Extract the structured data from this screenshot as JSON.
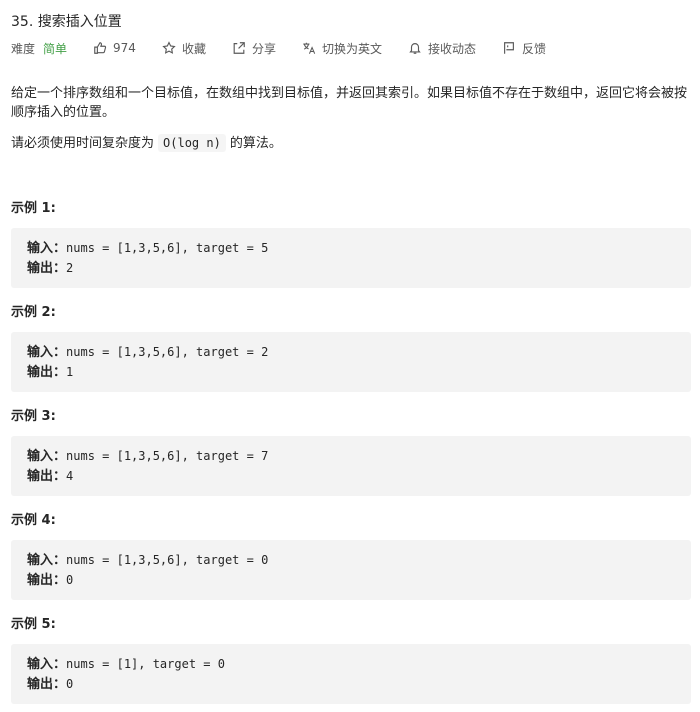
{
  "problem": {
    "title": "35. 搜索插入位置",
    "difficulty_label": "难度",
    "difficulty_value": "简单",
    "likes": "974",
    "actions": {
      "collect": "收藏",
      "share": "分享",
      "switch_lang": "切换为英文",
      "subscribe": "接收动态",
      "feedback": "反馈"
    },
    "description": "给定一个排序数组和一个目标值，在数组中找到目标值，并返回其索引。如果目标值不存在于数组中，返回它将会被按顺序插入的位置。",
    "requirement_before": "请必须使用时间复杂度为",
    "requirement_code": "O(log n)",
    "requirement_after": "的算法。"
  },
  "labels": {
    "input": "输入：",
    "output": "输出："
  },
  "examples": [
    {
      "title": "示例 1:",
      "input": "nums = [1,3,5,6], target = 5",
      "output": "2"
    },
    {
      "title": "示例 2:",
      "input": "nums = [1,3,5,6], target = 2",
      "output": "1"
    },
    {
      "title": "示例 3:",
      "input": "nums = [1,3,5,6], target = 7",
      "output": "4"
    },
    {
      "title": "示例 4:",
      "input": "nums = [1,3,5,6], target = 0",
      "output": "0"
    },
    {
      "title": "示例 5:",
      "input": "nums = [1], target = 0",
      "output": "0"
    }
  ],
  "colors": {
    "easy": "#43a047",
    "code_bg": "#f3f3f3"
  }
}
